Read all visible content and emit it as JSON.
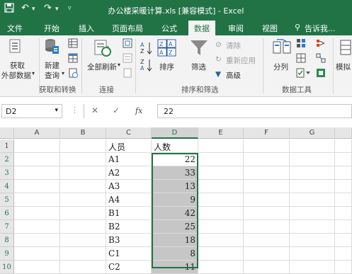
{
  "titlebar": {
    "title": "办公楼采暖计算.xls  [兼容模式] - Excel",
    "save_icon": "save-icon",
    "undo_icon": "undo-icon",
    "redo_icon": "redo-icon"
  },
  "tabs": [
    "文件",
    "开始",
    "插入",
    "页面布局",
    "公式",
    "数据",
    "审阅",
    "视图",
    "告诉我..."
  ],
  "active_tab": "数据",
  "ribbon": {
    "get_external_1": "获取",
    "get_external_2": "外部数据",
    "new_query_1": "新建",
    "new_query_2": "查询",
    "group_get_transform": "获取和转换",
    "refresh_all": "全部刷新",
    "group_connections": "连接",
    "sort": "排序",
    "filter": "筛选",
    "clear": "清除",
    "reapply": "重新应用",
    "advanced": "高级",
    "group_sort_filter": "排序和筛选",
    "text_to_columns": "分列",
    "group_data_tools": "数据工具",
    "what_if": "模拟"
  },
  "formula_bar": {
    "name_box": "D2",
    "fx": "fx",
    "value": "22"
  },
  "sheet": {
    "columns": [
      "A",
      "B",
      "C",
      "D",
      "E",
      "F",
      "G"
    ],
    "rows": [
      "1",
      "2",
      "3",
      "4",
      "5",
      "6",
      "7",
      "8",
      "9",
      "10"
    ],
    "header_c": "人员",
    "header_d": "人数",
    "people": [
      "A1",
      "A2",
      "A3",
      "A4",
      "B1",
      "B2",
      "B3",
      "C1",
      "C2"
    ],
    "counts": [
      "22",
      "33",
      "13",
      "9",
      "42",
      "25",
      "18",
      "8",
      "11"
    ]
  },
  "colors": {
    "accent": "#217346",
    "shade": "#c6c6c6"
  }
}
